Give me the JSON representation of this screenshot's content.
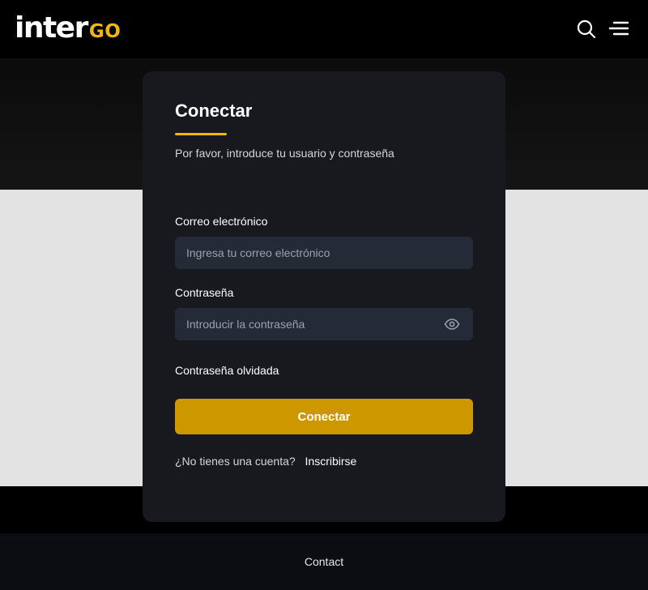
{
  "header": {
    "logo_main": "inter",
    "logo_accent": "GO",
    "search_icon": "search-icon",
    "menu_icon": "hamburger-menu-icon"
  },
  "login": {
    "title": "Conectar",
    "subtitle": "Por favor, introduce tu usuario y contraseña",
    "email_label": "Correo electrónico",
    "email_placeholder": "Ingresa tu correo electrónico",
    "email_value": "",
    "password_label": "Contraseña",
    "password_placeholder": "Introducir la contraseña",
    "password_value": "",
    "password_toggle_icon": "eye-icon",
    "forgot_label": "Contraseña olvidada",
    "submit_label": "Conectar",
    "no_account_text": "¿No tienes una cuenta?",
    "signup_label": "Inscribirse"
  },
  "footer": {
    "contact_label": "Contact"
  },
  "colors": {
    "accent": "#f5b800",
    "button": "#cd9700",
    "card_background": "#17191f",
    "input_background": "#252a37",
    "light_band": "#e3e3e3"
  }
}
